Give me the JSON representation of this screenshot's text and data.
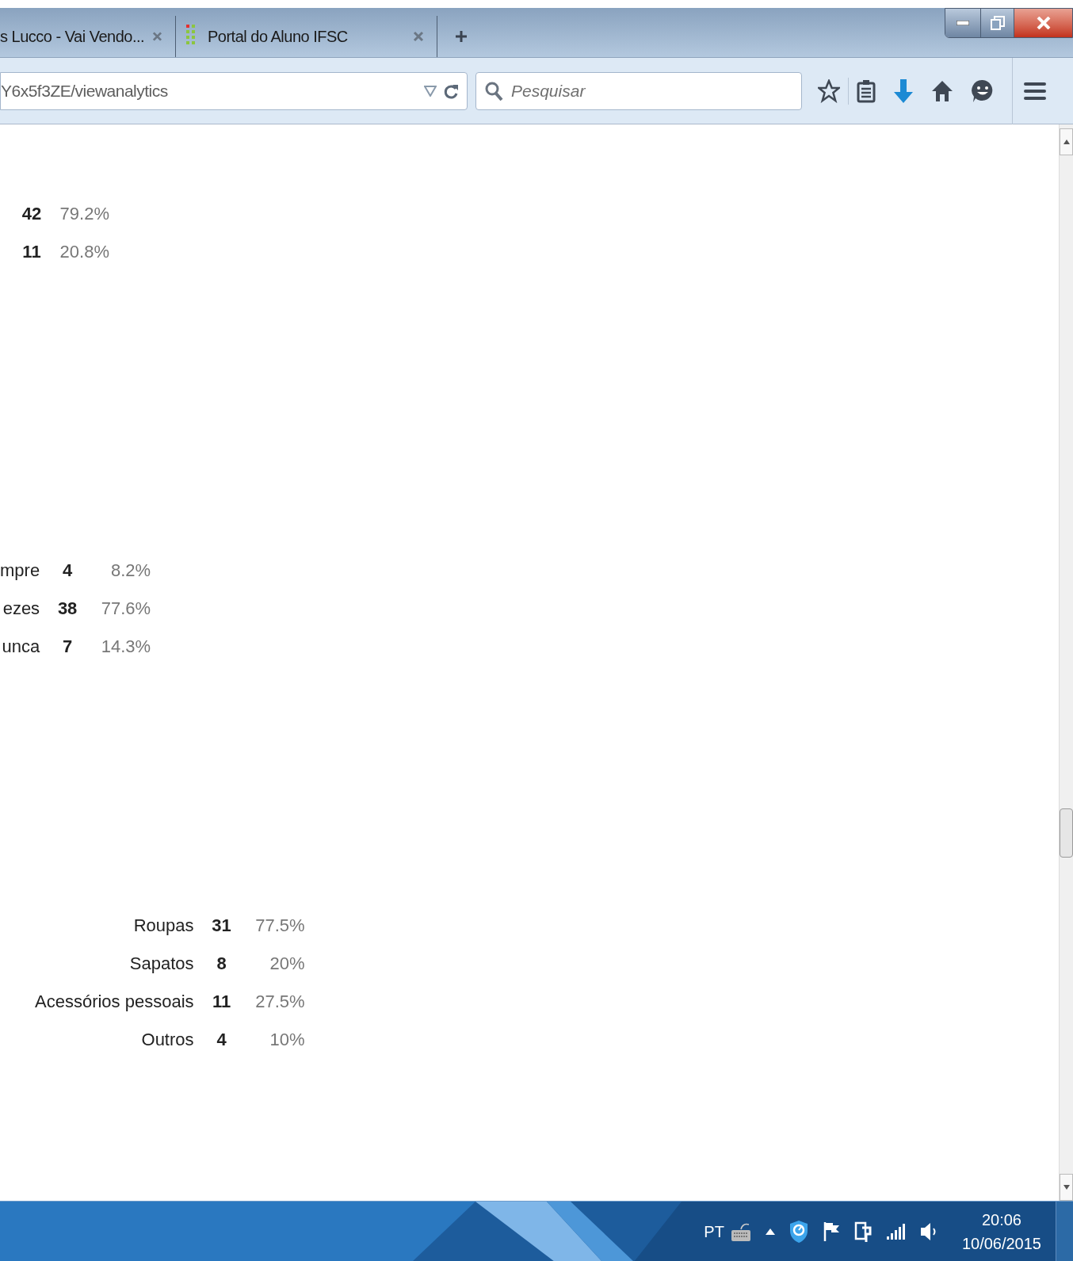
{
  "browser": {
    "tabs": [
      {
        "title": "s Lucco - Vai Vendo..."
      },
      {
        "title": "Portal do Aluno IFSC"
      }
    ],
    "address": "Y6x5f3ZE/viewanalytics",
    "search": {
      "placeholder": "Pesquisar"
    }
  },
  "summaries": [
    {
      "rows": [
        {
          "count": "42",
          "percent": "79.2%"
        },
        {
          "count": "11",
          "percent": "20.8%"
        }
      ]
    },
    {
      "rows": [
        {
          "label": "mpre",
          "count": "4",
          "percent": "8.2%"
        },
        {
          "label": "ezes",
          "count": "38",
          "percent": "77.6%"
        },
        {
          "label": "unca",
          "count": "7",
          "percent": "14.3%"
        }
      ]
    },
    {
      "rows": [
        {
          "label": "Roupas",
          "count": "31",
          "percent": "77.5%"
        },
        {
          "label": "Sapatos",
          "count": "8",
          "percent": "20%"
        },
        {
          "label": "Acessórios pessoais",
          "count": "11",
          "percent": "27.5%"
        },
        {
          "label": "Outros",
          "count": "4",
          "percent": "10%"
        }
      ]
    }
  ],
  "taskbar": {
    "language": "PT",
    "time": "20:06",
    "date": "10/06/2015"
  }
}
